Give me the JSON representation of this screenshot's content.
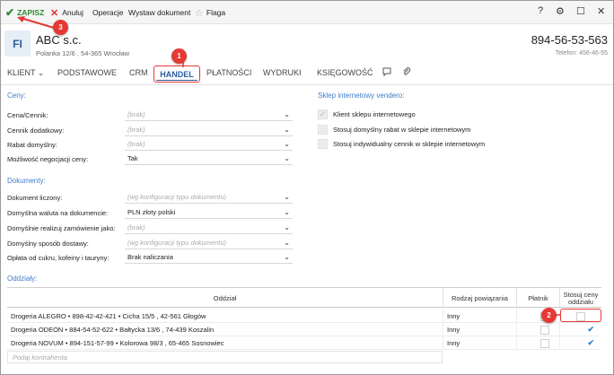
{
  "toolbar": {
    "save": "ZAPISZ",
    "cancel": "Anuluj",
    "operations": "Operacje",
    "issue_document": "Wystaw dokument",
    "flag": "Flaga",
    "help": "?",
    "settings": "⚙",
    "maximize": "☐",
    "close": "✕"
  },
  "header": {
    "avatar": "FI",
    "company": "ABC s.c.",
    "address": "Polanka 12/6 , 54-365 Wrocław",
    "phone": "894-56-53-563",
    "phone_sub": "Telefon: 456-46-55"
  },
  "tabs": [
    {
      "label": "KLIENT ⌄"
    },
    {
      "label": "PODSTAWOWE"
    },
    {
      "label": "CRM"
    },
    {
      "label": "HANDEL",
      "active": true
    },
    {
      "label": "PŁATNOŚCI"
    },
    {
      "label": "WYDRUKI"
    },
    {
      "label": "KSIĘGOWOŚĆ"
    }
  ],
  "prices": {
    "title": "Ceny:",
    "fields": [
      {
        "label": "Cena/Cennik:",
        "value": "(brak)",
        "placeholder": true
      },
      {
        "label": "Cennik dodatkowy:",
        "value": "(brak)",
        "placeholder": true
      },
      {
        "label": "Rabat domyślny:",
        "value": "(brak)",
        "placeholder": true
      },
      {
        "label": "Możliwość negocjacji ceny:",
        "value": "Tak",
        "placeholder": false
      }
    ]
  },
  "store": {
    "title": "Sklep internetowy vendero:",
    "options": [
      {
        "label": "Klient sklepu internetowego",
        "checked": true
      },
      {
        "label": "Stosuj domyślny rabat w sklepie internetowym",
        "checked": false
      },
      {
        "label": "Stosuj indywidualny cennik w sklepie internetowym",
        "checked": false
      }
    ]
  },
  "documents": {
    "title": "Dokumenty:",
    "fields": [
      {
        "label": "Dokument liczony:",
        "value": "(wg konfiguracji typu dokumentu)",
        "placeholder": true
      },
      {
        "label": "Domyślna waluta na dokumencie:",
        "value": "PLN złoty polski",
        "placeholder": false
      },
      {
        "label": "Domyślnie realizuj zamówienie jako:",
        "value": "(brak)",
        "placeholder": true
      },
      {
        "label": "Domyślny sposób dostawy:",
        "value": "(wg konfiguracji typu dokumentu)",
        "placeholder": true
      },
      {
        "label": "Opłata od cukru, kofeiny i tauryny:",
        "value": "Brak naliczania",
        "placeholder": false
      }
    ]
  },
  "branches": {
    "title": "Oddziały:",
    "headers": {
      "branch": "Oddział",
      "relation": "Rodzaj powiązania",
      "payer": "Płatnik",
      "prices": "Stosuj ceny oddziału"
    },
    "rows": [
      {
        "branch": "Drogeria ALEGRO • 898-42-42-421 • Cicha  15/5 , 42-561 Głogów",
        "relation": "Inny",
        "payer": false,
        "prices": false
      },
      {
        "branch": "Drogeria ODEON • 884-54-52-622 • Bałtycka  13/6 , 74-439 Koszalin",
        "relation": "Inny",
        "payer": false,
        "prices": true
      },
      {
        "branch": "Drogeria NOVUM • 894-151-57-99 • Kolorowa  98/3 , 65-465 Sosnowiec",
        "relation": "Inny",
        "payer": false,
        "prices": true
      }
    ],
    "add_placeholder": "Podaj kontrahenta"
  },
  "badges": {
    "one": "1",
    "two": "2",
    "three": "3"
  },
  "colors": {
    "accent": "#2c5d9e",
    "section": "#3d7cc9",
    "save": "#2e8b2e",
    "highlight": "#e53935"
  }
}
